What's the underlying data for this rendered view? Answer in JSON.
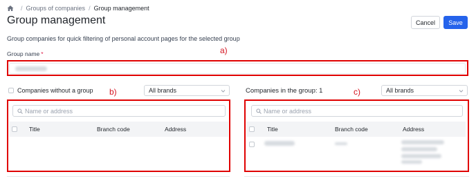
{
  "breadcrumb": {
    "icon": "home-icon",
    "items": [
      "Groups of companies",
      "Group management"
    ],
    "separator": "/"
  },
  "page": {
    "title": "Group management",
    "subtitle": "Group companies for quick filtering of personal account pages for the selected group"
  },
  "actions": {
    "cancel_label": "Cancel",
    "save_label": "Save",
    "save_color": "#2563eb"
  },
  "group_name": {
    "label": "Group name",
    "required_mark": "*"
  },
  "annotations": {
    "a": "a)",
    "b": "b)",
    "c": "c)",
    "highlight_color": "#e00000"
  },
  "left_panel": {
    "checkbox_label": "Companies without a group",
    "brand_select": "All brands",
    "search_placeholder": "Name or address",
    "columns": [
      "Title",
      "Branch code",
      "Address"
    ]
  },
  "right_panel": {
    "heading_label": "Companies in the group:",
    "heading_count": "1",
    "brand_select": "All brands",
    "search_placeholder": "Name or address",
    "columns": [
      "Title",
      "Branch code",
      "Address"
    ]
  }
}
